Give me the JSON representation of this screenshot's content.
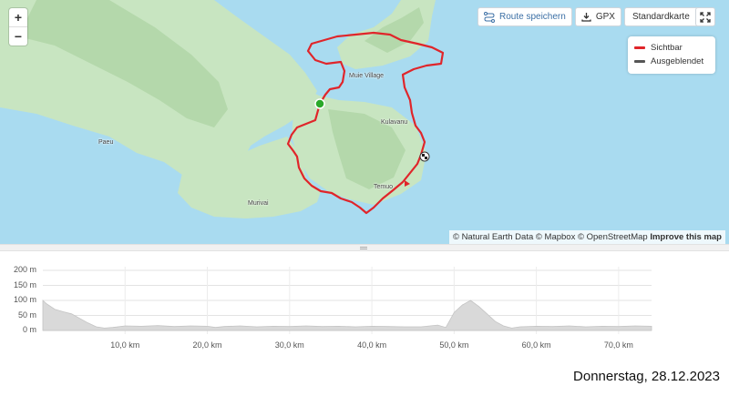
{
  "map": {
    "zoom_in_label": "+",
    "zoom_out_label": "−",
    "toolbar": {
      "save_route_label": "Route speichern",
      "gpx_label": "GPX",
      "map_style_label": "Standardkarte"
    },
    "legend": {
      "items": [
        {
          "label": "Sichtbar",
          "color": "#e0252a"
        },
        {
          "label": "Ausgeblendet",
          "color": "#555555"
        }
      ]
    },
    "place_labels": {
      "muie": "Muie Village",
      "paeu": "Paeu",
      "kulavanu": "Kulavanu",
      "temuo": "Temuo",
      "murivai": "Murivai"
    },
    "attribution": {
      "text": "© Natural Earth Data © Mapbox © OpenStreetMap",
      "improve_link": "Improve this map"
    },
    "colors": {
      "water": "#a9dbf0",
      "land": "#c7e4c0",
      "route": "#e0252a",
      "start": "#2aa82a"
    }
  },
  "chart_data": {
    "type": "area",
    "title": "",
    "xlabel": "",
    "ylabel": "",
    "y_ticks": [
      "200 m",
      "150 m",
      "100 m",
      "50 m",
      "0 m"
    ],
    "x_ticks": [
      "10,0 km",
      "20,0 km",
      "30,0 km",
      "40,0 km",
      "50,0 km",
      "60,0 km",
      "70,0 km"
    ],
    "xlim": [
      0,
      74
    ],
    "ylim": [
      0,
      200
    ],
    "grid": true,
    "series": [
      {
        "x": [
          0,
          0.5,
          1.5,
          2.5,
          3.5,
          4.5,
          5.5,
          6.5,
          7.5,
          8.5,
          10,
          12,
          14,
          16,
          18,
          20,
          21,
          22,
          24,
          26,
          28,
          30,
          32,
          34,
          36,
          38,
          40,
          42,
          44,
          46,
          48,
          49,
          50,
          51,
          52,
          53,
          54,
          55,
          56,
          57,
          58,
          60,
          62,
          64,
          66,
          68,
          70,
          72,
          74
        ],
        "y": [
          100,
          88,
          70,
          62,
          55,
          40,
          25,
          12,
          8,
          10,
          15,
          14,
          16,
          13,
          15,
          14,
          10,
          13,
          15,
          12,
          14,
          13,
          15,
          13,
          14,
          12,
          14,
          13,
          12,
          12,
          18,
          10,
          60,
          85,
          100,
          80,
          55,
          30,
          15,
          8,
          12,
          14,
          13,
          15,
          12,
          14,
          13,
          15,
          14
        ]
      }
    ]
  },
  "footer": {
    "date": "Donnerstag, 28.12.2023"
  }
}
